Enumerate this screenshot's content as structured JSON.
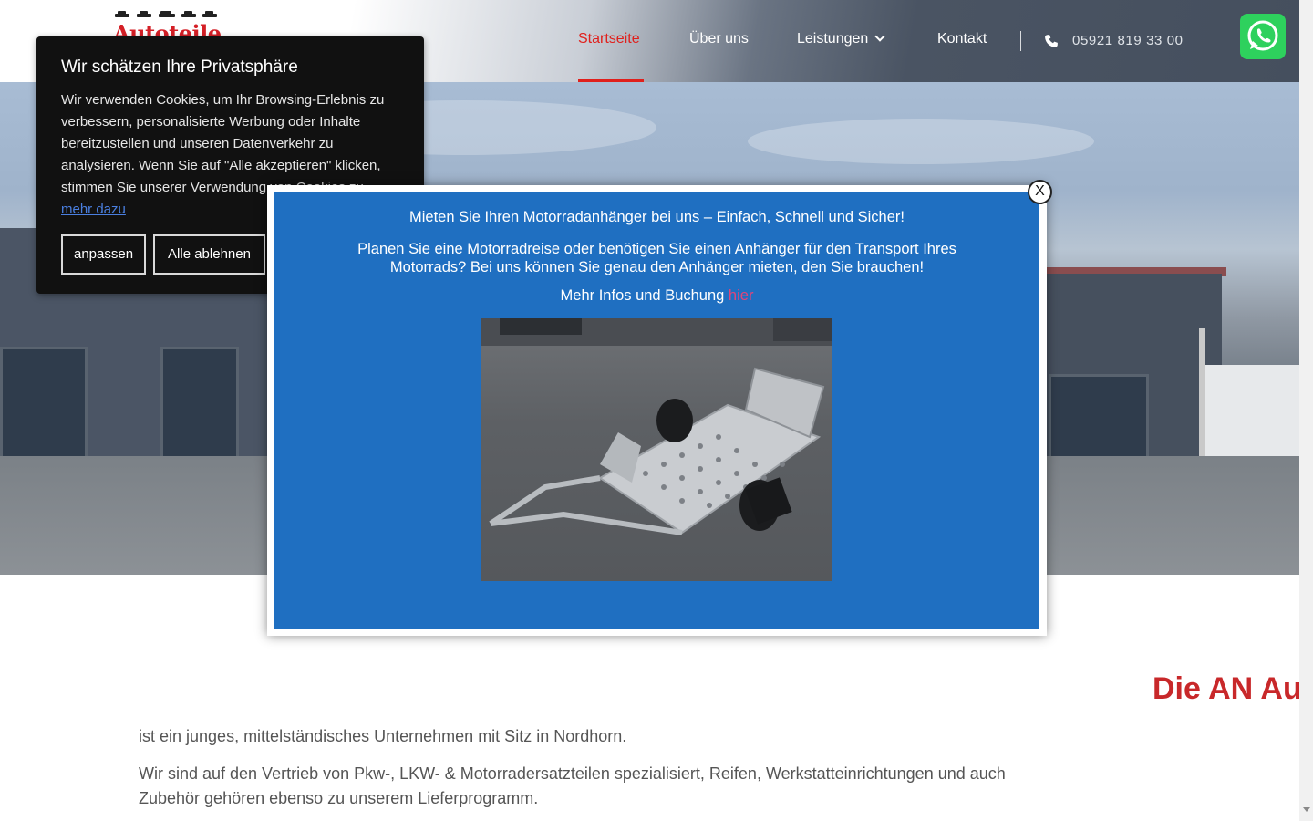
{
  "header": {
    "logo_text": "Autoteile",
    "nav": [
      {
        "label": "Startseite",
        "active": true
      },
      {
        "label": "Über uns"
      },
      {
        "label": "Leistungen"
      },
      {
        "label": "Kontakt"
      }
    ],
    "phone": "05921 819 33 00",
    "accent_color": "#e0201c"
  },
  "cookie_banner": {
    "title": "Wir schätzen Ihre Privatsphäre",
    "text": "Wir verwenden Cookies, um Ihr Browsing-Erlebnis zu verbessern, personalisierte Werbung oder Inhalte bereitzustellen und unseren Datenverkehr zu analysieren. Wenn Sie auf \"Alle akzeptieren\" klicken, stimmen Sie unserer Verwendung von Cookies zu.",
    "link_label": "mehr dazu",
    "customize_label": "anpassen",
    "reject_label": "Alle ablehnen"
  },
  "popup": {
    "close_label": "X",
    "headline": "Mieten Sie Ihren Motorradanhänger bei uns – Einfach, Schnell und Sicher!",
    "body": "Planen Sie eine Motorradreise oder benötigen Sie einen Anhänger für den Transport Ihres Motorrads? Bei uns können Sie genau den Anhänger mieten, den Sie brauchen!",
    "more_prefix": "Mehr Infos und Buchung ",
    "more_link": "hier",
    "background_color": "#1f6fc1"
  },
  "main": {
    "title": "Die AN Au",
    "paragraph1": "ist ein junges, mittelständisches Unternehmen mit Sitz in Nordhorn.",
    "paragraph2_line1": "Wir sind auf den Vertrieb von Pkw-, LKW- & Motorradersatzteilen spezialisiert, Reifen, Werkstatteinrichtungen und auch",
    "paragraph2_line2": "Zubehör gehören ebenso zu unserem Lieferprogramm."
  },
  "icons": {
    "phone": "phone-icon",
    "whatsapp": "whatsapp-icon",
    "dropdown": "chevron-down-icon"
  }
}
